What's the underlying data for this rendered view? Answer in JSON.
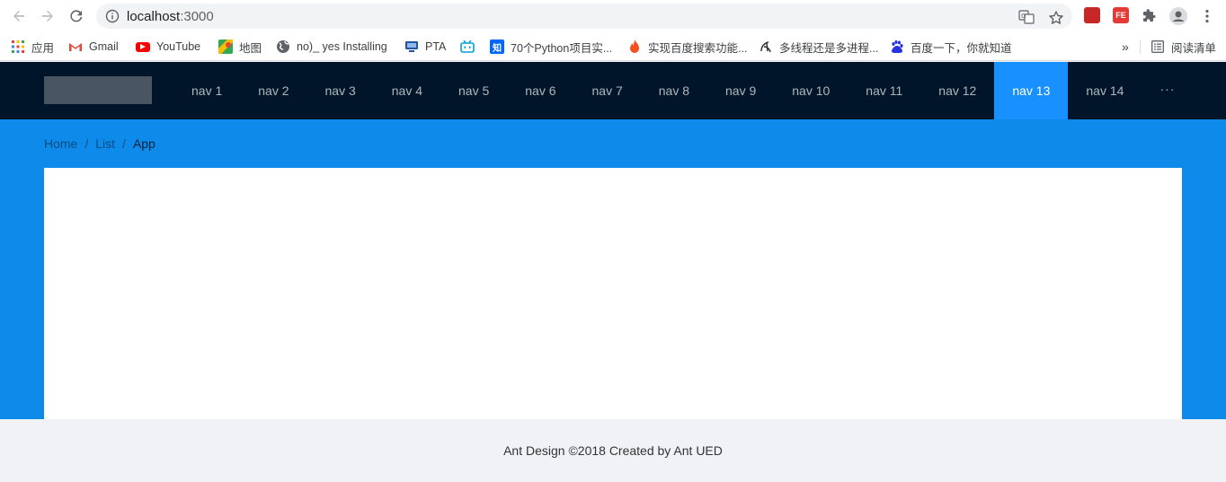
{
  "browser": {
    "url_host": "localhost",
    "url_port": ":3000",
    "bookmarks": [
      {
        "label": "应用",
        "icon": "apps-grid-icon"
      },
      {
        "label": "Gmail",
        "icon": "gmail-icon"
      },
      {
        "label": "YouTube",
        "icon": "youtube-icon"
      },
      {
        "label": "地图",
        "icon": "maps-icon"
      },
      {
        "label": "no)_ yes Installing",
        "icon": "globe-icon"
      },
      {
        "label": "PTA",
        "icon": "pta-icon"
      },
      {
        "label": "",
        "icon": "bilibili-icon"
      },
      {
        "label": "70个Python项目实...",
        "icon": "zhihu-icon"
      },
      {
        "label": "实现百度搜索功能...",
        "icon": "flame-icon"
      },
      {
        "label": "多线程还是多进程...",
        "icon": "csdn-icon"
      },
      {
        "label": "百度一下，你就知道",
        "icon": "baidu-icon"
      }
    ],
    "overflow_label": "»",
    "reading_list_label": "阅读清单"
  },
  "header": {
    "menu": [
      {
        "label": "nav 1"
      },
      {
        "label": "nav 2"
      },
      {
        "label": "nav 3"
      },
      {
        "label": "nav 4"
      },
      {
        "label": "nav 5"
      },
      {
        "label": "nav 6"
      },
      {
        "label": "nav 7"
      },
      {
        "label": "nav 8"
      },
      {
        "label": "nav 9"
      },
      {
        "label": "nav 10"
      },
      {
        "label": "nav 11"
      },
      {
        "label": "nav 12"
      },
      {
        "label": "nav 13",
        "active": true
      },
      {
        "label": "nav 14"
      }
    ],
    "more_label": "···"
  },
  "breadcrumb": {
    "items": [
      "Home",
      "List",
      "App"
    ],
    "separator": "/"
  },
  "footer": {
    "text": "Ant Design ©2018 Created by Ant UED"
  },
  "colors": {
    "header_bg": "#001529",
    "active_menu": "#1890ff",
    "content_bg": "#0e8aea",
    "footer_bg": "#f0f2f5"
  }
}
